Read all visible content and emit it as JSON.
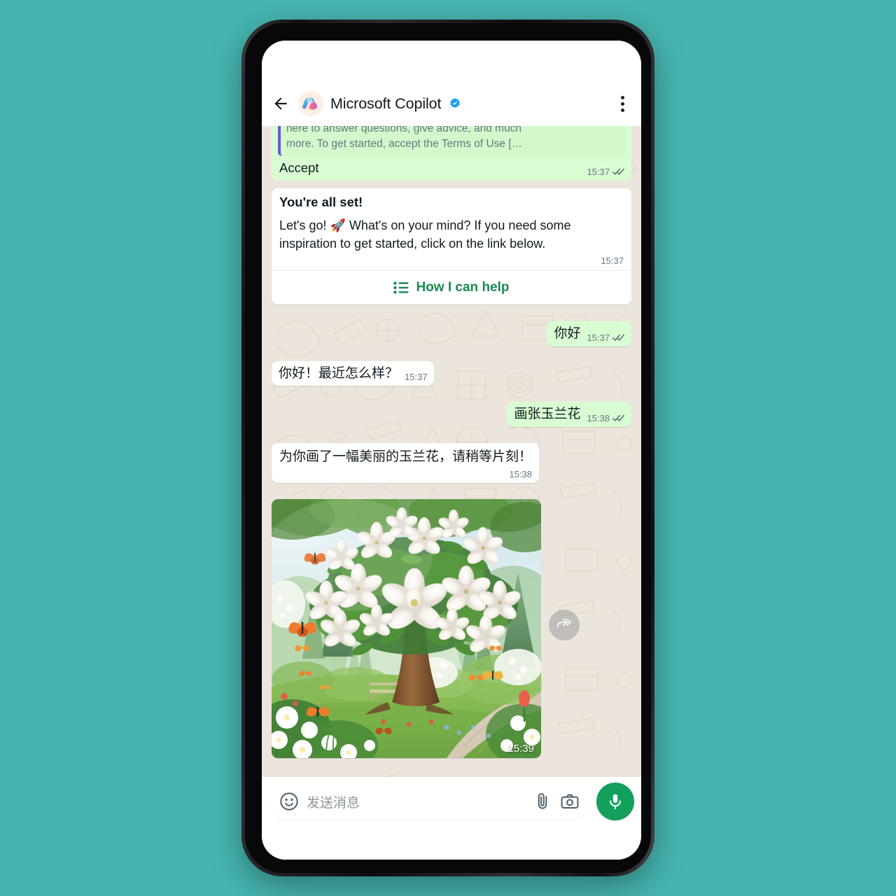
{
  "theme": {
    "page_background": "#46b5b0",
    "chat_background": "#ece5dd",
    "outgoing_bubble": "#d9fdd3",
    "incoming_bubble": "#ffffff",
    "accent_green": "#1c8a53",
    "mic_button_green": "#12a05c",
    "verified_blue": "#1d9bf0",
    "quote_bar_purple": "#6a56d6"
  },
  "header": {
    "back_icon": "back-arrow-icon",
    "avatar_icon": "copilot-logo-icon",
    "contact_name": "Microsoft Copilot",
    "verified_icon": "verified-badge-icon",
    "menu_icon": "overflow-menu-icon"
  },
  "messages": [
    {
      "id": "accept-msg",
      "direction": "out",
      "quoted_text": "here to answer questions, give advice, and much\nmore. To get started, accept the Terms of Use […",
      "text": "Accept",
      "time": "15:37",
      "status": "read"
    },
    {
      "id": "allset-card",
      "direction": "in",
      "title": "You're all set!",
      "text": "Let's go! 🚀 What's on your mind? If you need some inspiration to get started, click on the link below.",
      "time": "15:37",
      "link_label": "How I can help",
      "link_icon": "list-icon"
    },
    {
      "id": "hello-out",
      "direction": "out",
      "text": "你好",
      "time": "15:37",
      "status": "read"
    },
    {
      "id": "hello-in",
      "direction": "in",
      "text": "你好！最近怎么样？",
      "time": "15:37"
    },
    {
      "id": "draw-request",
      "direction": "out",
      "text": "画张玉兰花",
      "time": "15:38",
      "status": "read"
    },
    {
      "id": "draw-reply",
      "direction": "in",
      "text": "为你画了一幅美丽的玉兰花，请稍等片刻！",
      "time": "15:38"
    },
    {
      "id": "magnolia-image",
      "direction": "in",
      "type": "image",
      "alt": "Illustration of a blooming white magnolia tree in a lush garden with butterflies",
      "time": "15:39",
      "forward_icon": "forward-arrow-icon"
    }
  ],
  "composer": {
    "emoji_icon": "emoji-smiley-icon",
    "placeholder": "发送消息",
    "attach_icon": "paperclip-icon",
    "camera_icon": "camera-icon",
    "mic_icon": "microphone-icon"
  }
}
